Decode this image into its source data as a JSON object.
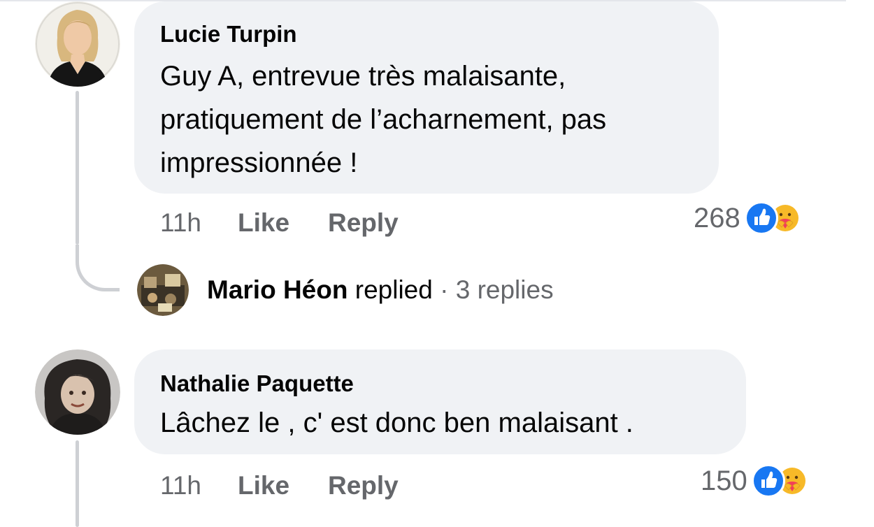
{
  "comments": [
    {
      "author": "Lucie Turpin",
      "text": "Guy A, entrevue très malaisante, pratiquement de l’acharnement, pas impressionnée !",
      "time": "11h",
      "like_label": "Like",
      "reply_label": "Reply",
      "reaction_count": "268",
      "reaction_icons": [
        "like-icon",
        "care-icon"
      ]
    },
    {
      "author": "Nathalie Paquette",
      "text": "Lâchez le , c' est donc ben malaisant .",
      "time": "11h",
      "like_label": "Like",
      "reply_label": "Reply",
      "reaction_count": "150",
      "reaction_icons": [
        "like-icon",
        "care-icon"
      ]
    }
  ],
  "reply_summary": {
    "name": "Mario Héon",
    "verb": "replied",
    "separator": "·",
    "count_label": "3 replies"
  },
  "colors": {
    "bubble": "#f0f2f5",
    "meta_text": "#65676b",
    "like_blue": "#1877f2",
    "care_yellow": "#f7b928"
  }
}
